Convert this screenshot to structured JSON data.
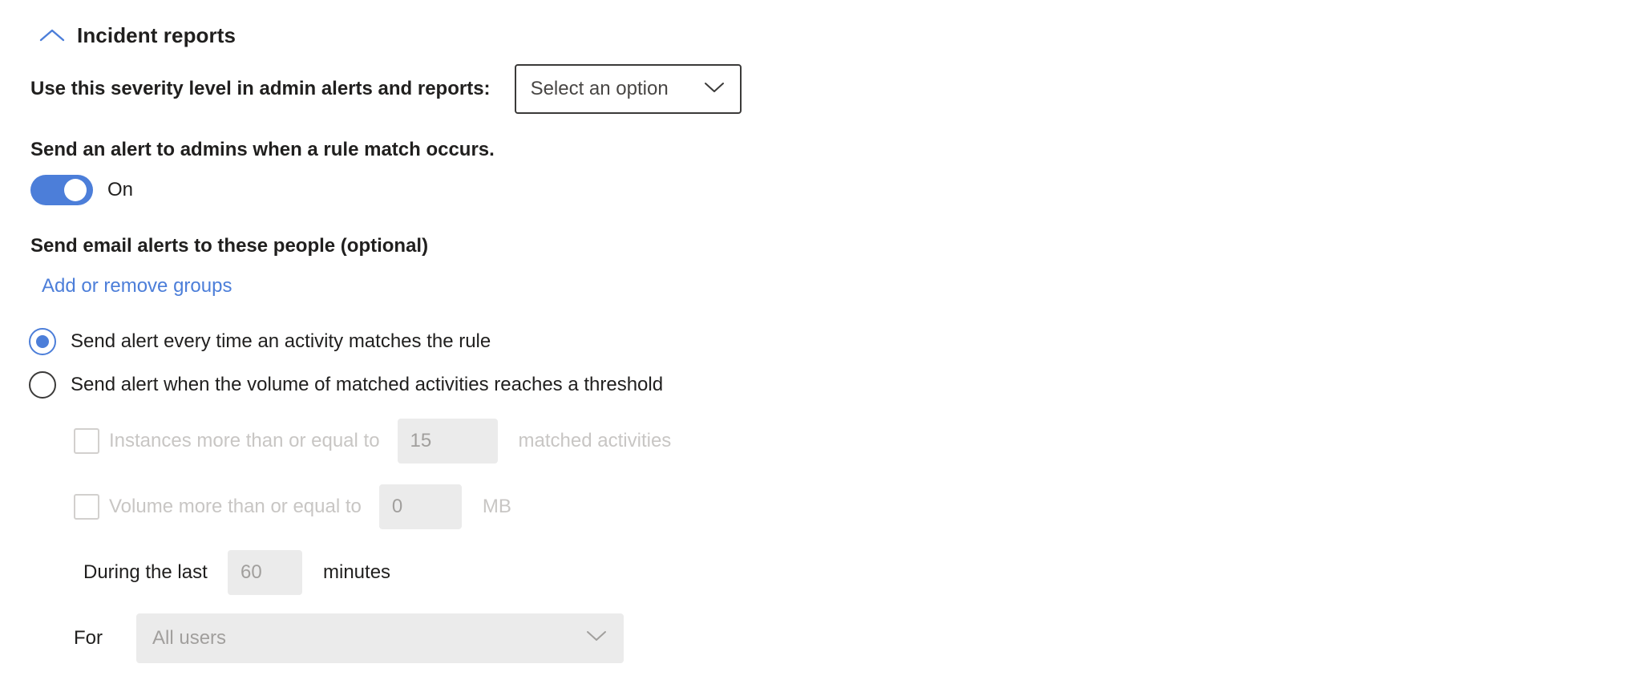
{
  "section": {
    "title": "Incident reports",
    "collapse_icon": "chevron-up-icon"
  },
  "severity": {
    "label": "Use this severity level in admin alerts and reports:",
    "dropdown": {
      "value": "Select an option",
      "placeholder": "Select an option",
      "icon": "chevron-down-icon"
    }
  },
  "admin_alert": {
    "label": "Send an alert to admins when a rule match occurs.",
    "toggle": {
      "state": "On",
      "checked": true
    }
  },
  "email_alerts": {
    "label": "Send email alerts to these people (optional)",
    "link": "Add or remove groups"
  },
  "alert_mode": {
    "options": [
      {
        "label": "Send alert every time an activity matches the rule",
        "selected": true
      },
      {
        "label": "Send alert when the volume of matched activities reaches a threshold",
        "selected": false
      }
    ]
  },
  "threshold": {
    "instances": {
      "checkbox_label": "Instances more than or equal to",
      "value": "15",
      "unit": "matched activities",
      "checked": false,
      "disabled": true
    },
    "volume": {
      "checkbox_label": "Volume more than or equal to",
      "value": "0",
      "unit": "MB",
      "checked": false,
      "disabled": true
    },
    "duration": {
      "label": "During the last",
      "value": "60",
      "unit": "minutes"
    },
    "scope": {
      "label": "For",
      "value": "All users",
      "icon": "chevron-down-icon"
    }
  },
  "colors": {
    "accent": "#4c7ed9",
    "text": "#201f1e",
    "disabled_text": "#c8c6c4",
    "disabled_field_bg": "#ebebeb",
    "border": "#3b3a39"
  }
}
